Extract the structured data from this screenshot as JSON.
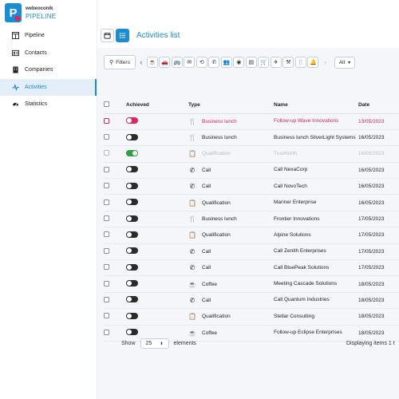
{
  "app": {
    "brand": "webeoconik",
    "name": "PIPELINE",
    "logo_letter": "P"
  },
  "sidebar": {
    "items": [
      {
        "label": "Pipeline",
        "icon": "board-icon"
      },
      {
        "label": "Contacts",
        "icon": "contact-card-icon"
      },
      {
        "label": "Companies",
        "icon": "building-icon"
      },
      {
        "label": "Activities",
        "icon": "pulse-icon",
        "active": true
      },
      {
        "label": "Statistics",
        "icon": "gauge-icon"
      }
    ]
  },
  "topbar": {
    "title": "Activities list",
    "views": [
      "calendar-view-icon",
      "list-view-icon"
    ]
  },
  "filterbar": {
    "filters_label": "Filters",
    "type_chips": [
      "coffee-icon",
      "car-icon",
      "bus-icon",
      "email-icon",
      "history-icon",
      "phone-icon",
      "group-icon",
      "target-icon",
      "document-icon",
      "cart-icon",
      "plane-icon",
      "tool-icon",
      "restaurant-icon",
      "bell-icon"
    ],
    "scope_value": "All"
  },
  "table": {
    "headers": {
      "achieved": "Achieved",
      "type": "Type",
      "name": "Name",
      "date": "Date"
    },
    "rows": [
      {
        "status": "late",
        "type": "Business lunch",
        "icon": "fork-knife-icon",
        "glyph": "🍴",
        "name": "Follow-up Wave Innovations",
        "date": "13/05/2023"
      },
      {
        "status": "normal",
        "type": "Business lunch",
        "icon": "fork-knife-icon",
        "glyph": "🍴",
        "name": "Business lunch SilverLight Systems",
        "date": "16/05/2023"
      },
      {
        "status": "done",
        "type": "Qualification",
        "icon": "clipboard-icon",
        "glyph": "📋",
        "name": "TrueNorth",
        "date": "16/05/2023"
      },
      {
        "status": "normal",
        "type": "Call",
        "icon": "phone-icon",
        "glyph": "✆",
        "name": "Call NexaCorp",
        "date": "16/05/2023"
      },
      {
        "status": "normal",
        "type": "Call",
        "icon": "phone-icon",
        "glyph": "✆",
        "name": "Call NovoTech",
        "date": "16/05/2023"
      },
      {
        "status": "normal",
        "type": "Qualification",
        "icon": "clipboard-icon",
        "glyph": "📋",
        "name": "Mariner Enterprise",
        "date": "16/05/2023"
      },
      {
        "status": "normal",
        "type": "Business lunch",
        "icon": "fork-knife-icon",
        "glyph": "🍴",
        "name": "Frontier Innovations",
        "date": "17/05/2023"
      },
      {
        "status": "normal",
        "type": "Qualification",
        "icon": "clipboard-icon",
        "glyph": "📋",
        "name": "Alpine Solutions",
        "date": "17/05/2023"
      },
      {
        "status": "normal",
        "type": "Call",
        "icon": "phone-icon",
        "glyph": "✆",
        "name": "Call Zenith Enterprises",
        "date": "17/05/2023"
      },
      {
        "status": "normal",
        "type": "Call",
        "icon": "phone-icon",
        "glyph": "✆",
        "name": "Call BluePeak Solutions",
        "date": "17/05/2023"
      },
      {
        "status": "normal",
        "type": "Coffee",
        "icon": "coffee-icon",
        "glyph": "☕",
        "name": "Meeting Cascade Solutions",
        "date": "18/05/2023"
      },
      {
        "status": "normal",
        "type": "Call",
        "icon": "phone-icon",
        "glyph": "✆",
        "name": "Call Quantum Industries",
        "date": "18/05/2023"
      },
      {
        "status": "normal",
        "type": "Qualification",
        "icon": "clipboard-icon",
        "glyph": "📋",
        "name": "Stellar Consulting",
        "date": "18/05/2023"
      },
      {
        "status": "normal",
        "type": "Coffee",
        "icon": "coffee-icon",
        "glyph": "☕",
        "name": "Follow-up Eclipse Enterprises",
        "date": "18/05/2023"
      }
    ]
  },
  "footer": {
    "show_label": "Show",
    "page_size": "25",
    "elements_label": "elements",
    "displaying": "Displaying items 1 t"
  },
  "colors": {
    "accent": "#1b8ccf",
    "late": "#e0245e",
    "done_toggle": "#2e9e46"
  }
}
